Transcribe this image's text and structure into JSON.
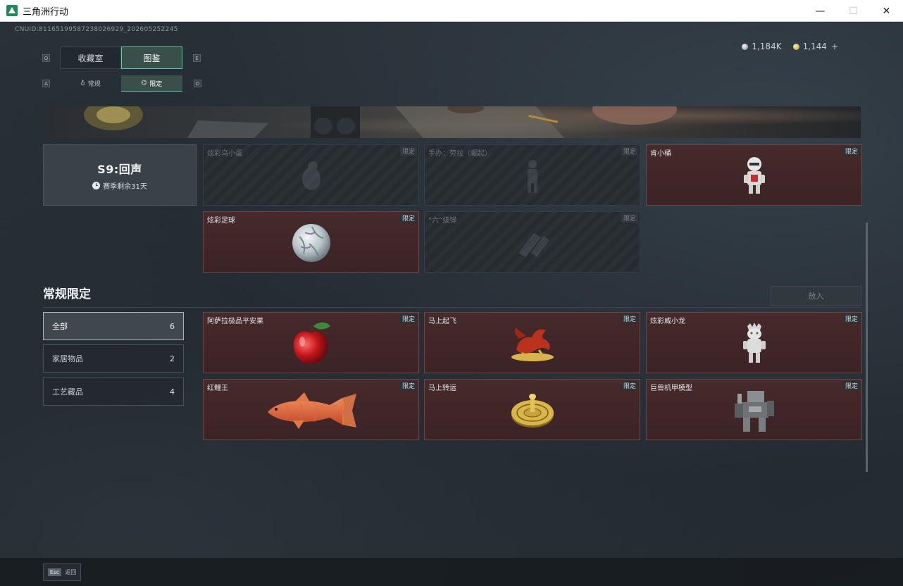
{
  "window": {
    "title": "三角洲行动",
    "minimize": "—",
    "maximize": "☐",
    "close": "✕"
  },
  "uid": "CNUID:81165199587238026929_202605252245",
  "currency": {
    "silver": "1,184K",
    "gold": "1,144",
    "add": "+"
  },
  "tabs": {
    "key_left": "Q",
    "key_right": "E",
    "main": [
      {
        "label": "收藏室"
      },
      {
        "label": "图鉴"
      }
    ],
    "sub_key_left": "A",
    "sub_key_right": "D",
    "sub": [
      {
        "label": "常规"
      },
      {
        "label": "限定"
      }
    ]
  },
  "season": {
    "title": "S9:回声",
    "remaining": "赛季剩余31天"
  },
  "season_items": [
    {
      "name": "炫彩乌小蛋",
      "tag": "限定",
      "owned": false
    },
    {
      "name": "手办：劳拉（崛起）",
      "tag": "限定",
      "owned": false
    },
    {
      "name": "肯小桶",
      "tag": "限定",
      "owned": true
    },
    {
      "name": "炫彩足球",
      "tag": "限定",
      "owned": true
    },
    {
      "name": "“六”级弹",
      "tag": "限定",
      "owned": false
    }
  ],
  "section": {
    "title": "常规限定",
    "place_button": "放入"
  },
  "filters": [
    {
      "label": "全部",
      "count": "6"
    },
    {
      "label": "家居物品",
      "count": "2"
    },
    {
      "label": "工艺藏品",
      "count": "4"
    }
  ],
  "regular_items": [
    {
      "name": "阿萨拉极品平安果",
      "tag": "限定"
    },
    {
      "name": "马上起飞",
      "tag": "限定"
    },
    {
      "name": "炫彩威小龙",
      "tag": "限定"
    },
    {
      "name": "红鲤王",
      "tag": "限定"
    },
    {
      "name": "马上转运",
      "tag": "限定"
    },
    {
      "name": "巨兽机甲模型",
      "tag": "限定"
    }
  ],
  "footer": {
    "esc_key": "Esc",
    "esc_label": "返回"
  }
}
